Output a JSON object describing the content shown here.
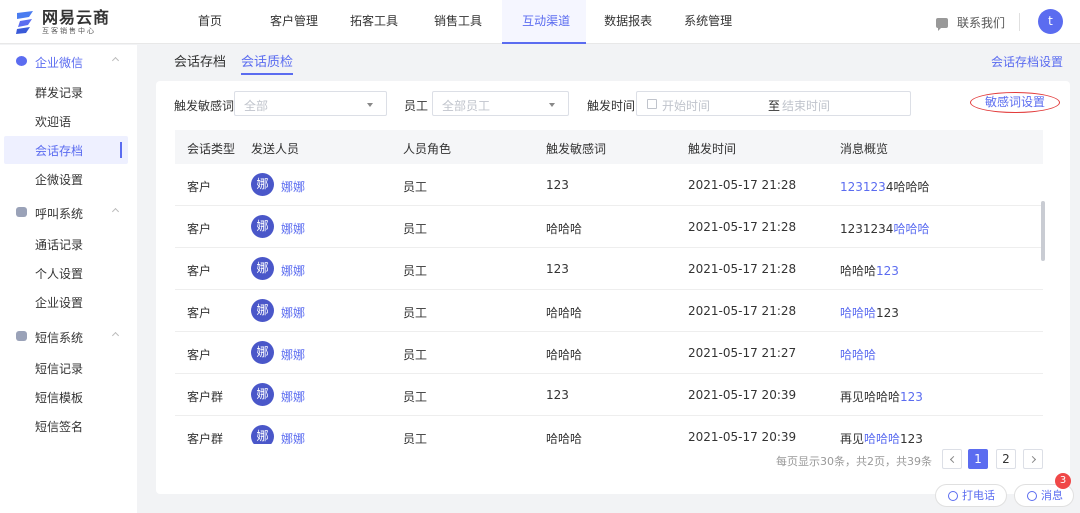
{
  "brand": {
    "name": "网易云商",
    "tagline": "互客销售中心"
  },
  "topnav": {
    "items": [
      "首页",
      "客户管理",
      "拓客工具",
      "销售工具",
      "互动渠道",
      "数据报表",
      "系统管理"
    ],
    "active_index": 4,
    "contact_label": "联系我们",
    "avatar_letter": "t",
    "accent_color": "#5b6cf0"
  },
  "sidebar": {
    "groups": [
      {
        "label": "企业微信",
        "icon": "wecom-icon",
        "items": [
          "群发记录",
          "欢迎语",
          "会话存档",
          "企微设置"
        ]
      },
      {
        "label": "呼叫系统",
        "icon": "phone-icon",
        "items": [
          "通话记录",
          "个人设置",
          "企业设置"
        ]
      },
      {
        "label": "短信系统",
        "icon": "message-icon",
        "items": [
          "短信记录",
          "短信模板",
          "短信签名"
        ]
      }
    ],
    "active_item": "会话存档"
  },
  "tabs": {
    "items": [
      "会话存档",
      "会话质检"
    ],
    "active_index": 1,
    "right_link": "会话存档设置"
  },
  "filters": {
    "sensitive_word_label": "触发敏感词",
    "sensitive_word_placeholder": "全部",
    "employee_label": "员工",
    "employee_placeholder": "全部员工",
    "time_label": "触发时间",
    "start_placeholder": "开始时间",
    "range_sep": "至",
    "end_placeholder": "结束时间",
    "settings_link": "敏感词设置"
  },
  "table": {
    "columns": [
      "会话类型",
      "发送人员",
      "人员角色",
      "触发敏感词",
      "触发时间",
      "消息概览"
    ],
    "rows": [
      {
        "type": "客户",
        "avatar": "娜",
        "sender": "娜娜",
        "role": "员工",
        "word": "123",
        "time": "2021-05-17 21:28",
        "msg_hl": "123123",
        "msg_rest": "4哈哈哈",
        "hl_first": true
      },
      {
        "type": "客户",
        "avatar": "娜",
        "sender": "娜娜",
        "role": "员工",
        "word": "哈哈哈",
        "time": "2021-05-17 21:28",
        "msg_pre": "1231234",
        "msg_hl": "哈哈哈"
      },
      {
        "type": "客户",
        "avatar": "娜",
        "sender": "娜娜",
        "role": "员工",
        "word": "123",
        "time": "2021-05-17 21:28",
        "msg_pre": "哈哈哈",
        "msg_hl": "123"
      },
      {
        "type": "客户",
        "avatar": "娜",
        "sender": "娜娜",
        "role": "员工",
        "word": "哈哈哈",
        "time": "2021-05-17 21:28",
        "msg_hl": "哈哈哈",
        "msg_rest": "123",
        "hl_first": true
      },
      {
        "type": "客户",
        "avatar": "娜",
        "sender": "娜娜",
        "role": "员工",
        "word": "哈哈哈",
        "time": "2021-05-17 21:27",
        "msg_hl": "哈哈哈"
      },
      {
        "type": "客户群",
        "avatar": "娜",
        "sender": "娜娜",
        "role": "员工",
        "word": "123",
        "time": "2021-05-17 20:39",
        "msg_pre": "再见哈哈哈",
        "msg_hl": "123"
      },
      {
        "type": "客户群",
        "avatar": "娜",
        "sender": "娜娜",
        "role": "员工",
        "word": "哈哈哈",
        "time": "2021-05-17 20:39",
        "msg_pre": "再见",
        "msg_hl": "哈哈哈",
        "msg_rest": "123"
      }
    ]
  },
  "pagination": {
    "info": "每页显示30条，共2页，共39条",
    "pages": [
      "1",
      "2"
    ],
    "current": "1"
  },
  "floating": {
    "call_label": "打电话",
    "message_label": "消息",
    "message_badge": "3"
  }
}
